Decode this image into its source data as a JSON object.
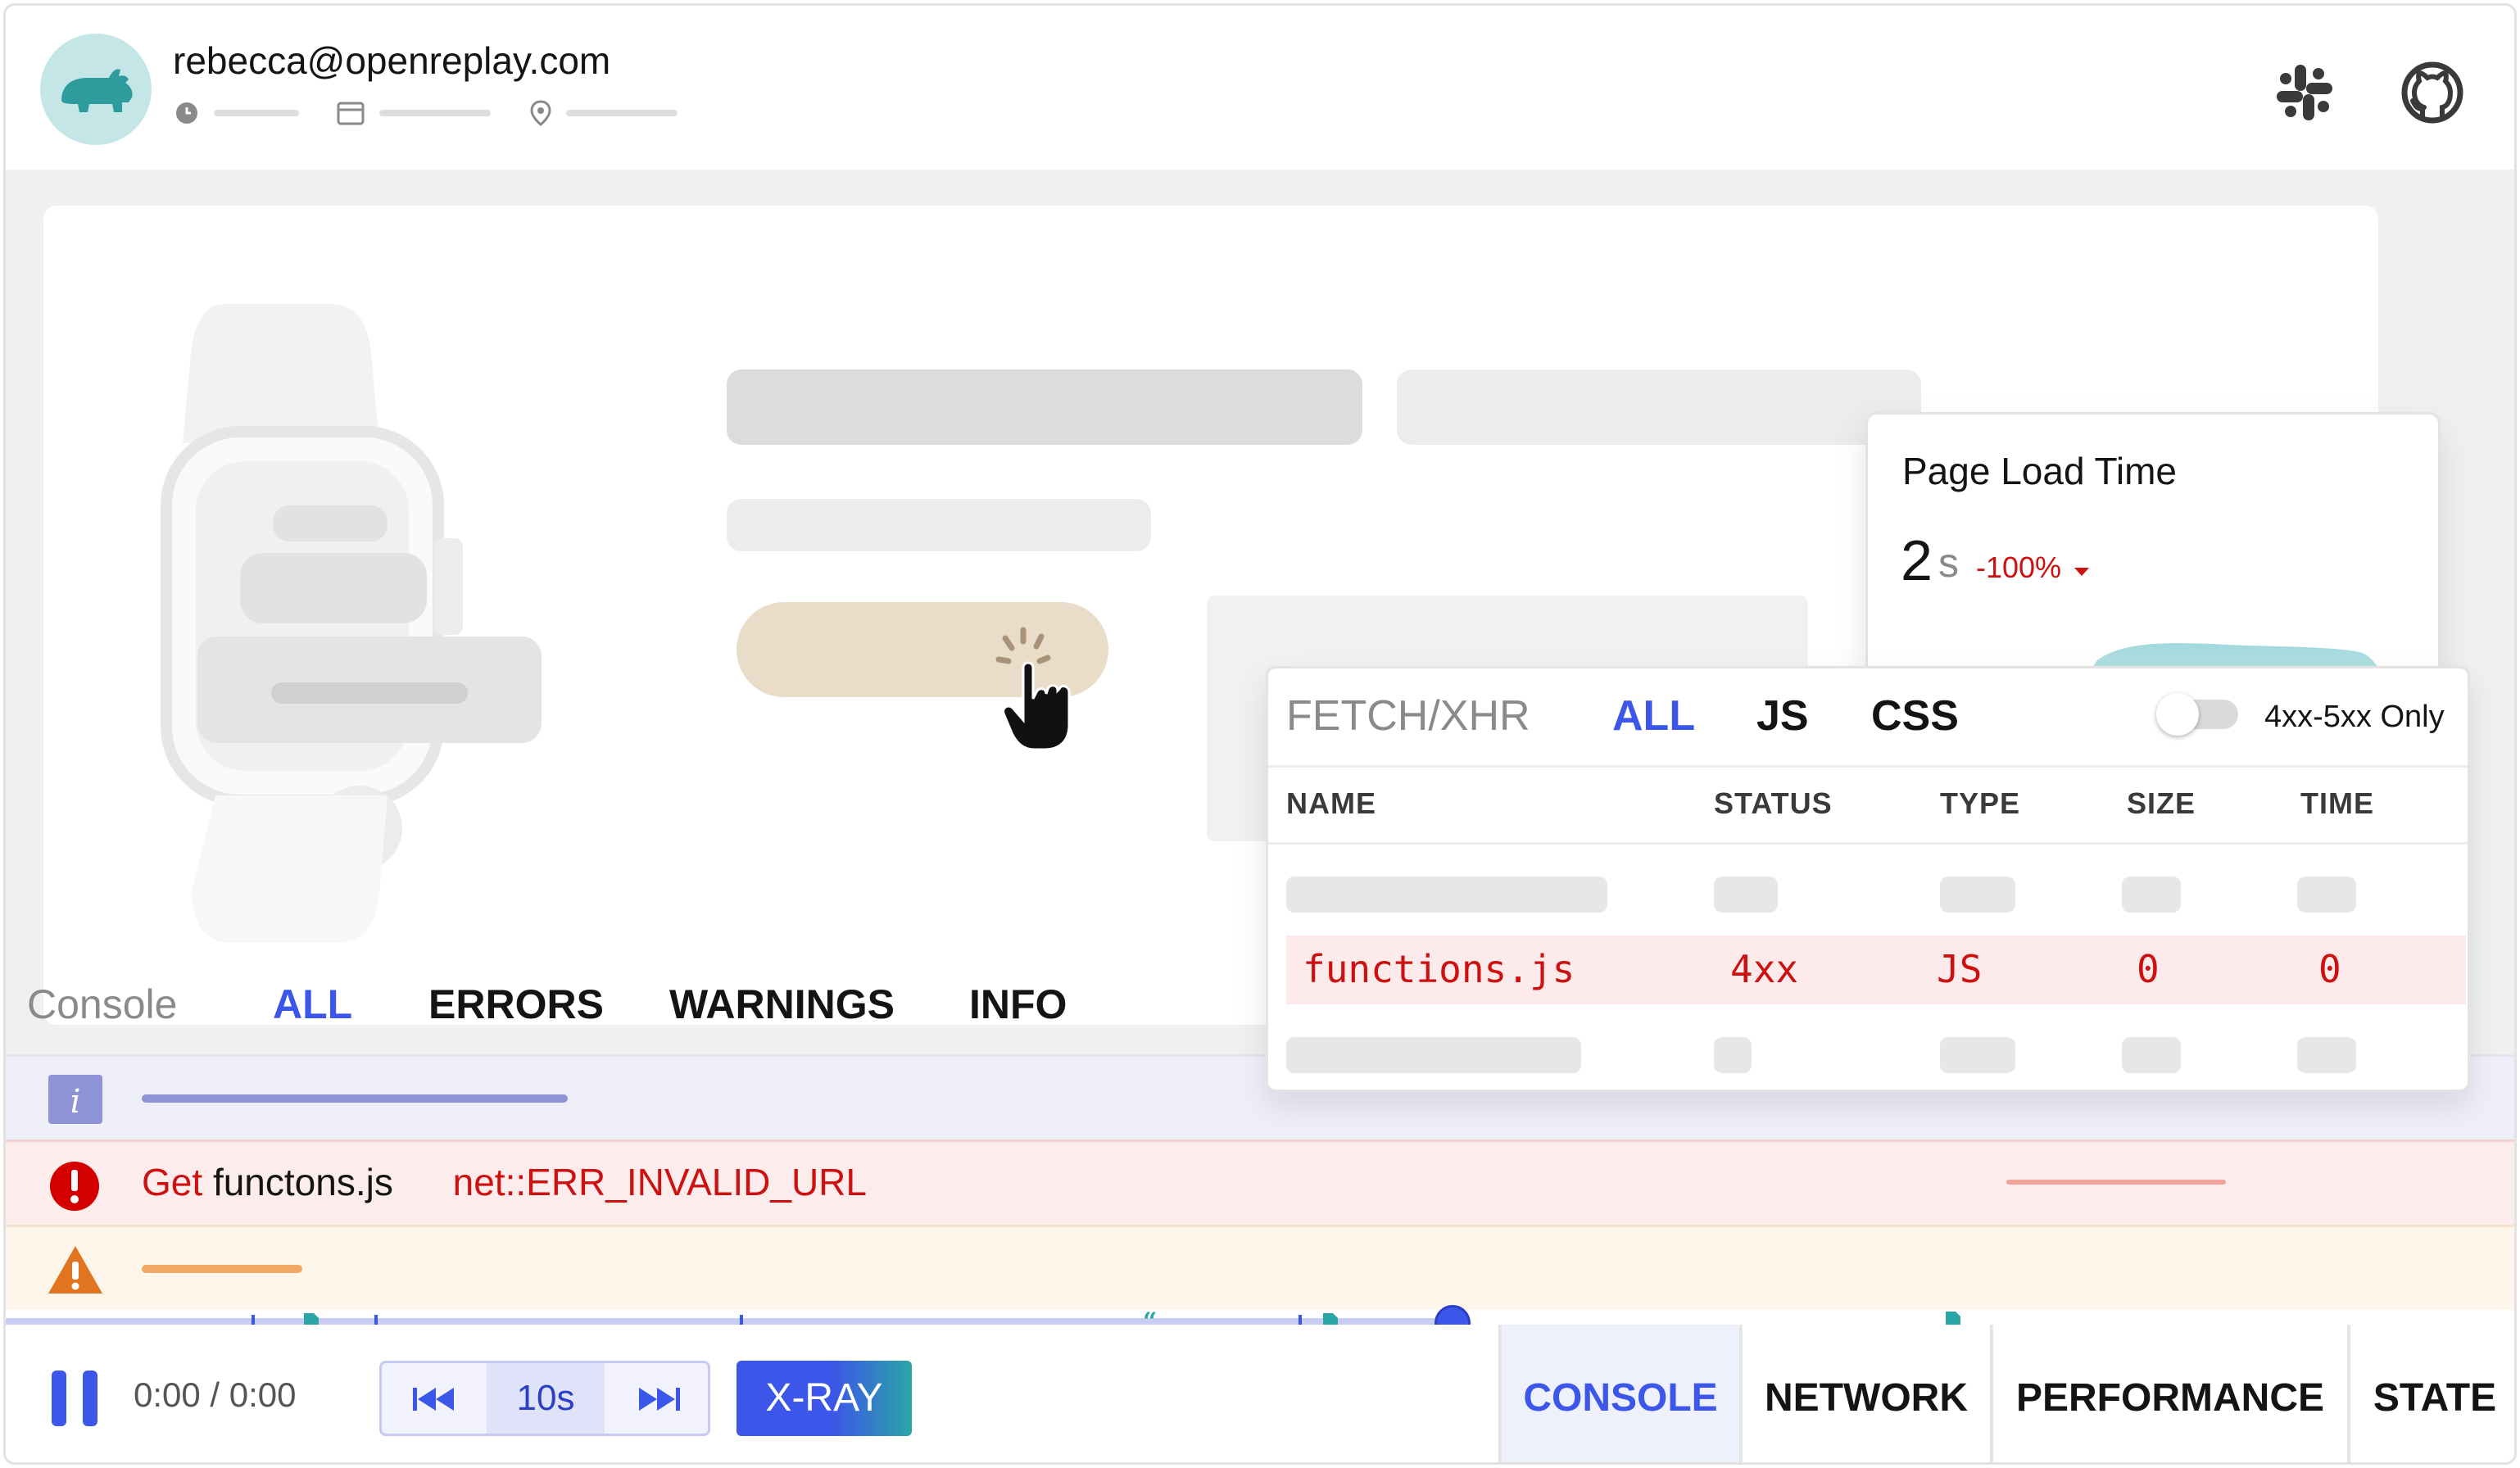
{
  "header": {
    "user_email": "rebecca@openreplay.com",
    "meta_icons": [
      "clock-icon",
      "calendar-icon",
      "location-pin-icon"
    ],
    "right_icons": [
      "slack-icon",
      "github-icon"
    ]
  },
  "page_load_card": {
    "title": "Page Load Time",
    "value": "2",
    "unit": "s",
    "delta": "-100%",
    "delta_color": "#cc1111",
    "chart_color": "#9fd8dc"
  },
  "network": {
    "tabs": [
      {
        "label": "FETCH/XHR",
        "active": false
      },
      {
        "label": "ALL",
        "active": true
      },
      {
        "label": "JS",
        "active": false
      },
      {
        "label": "CSS",
        "active": false
      }
    ],
    "toggle_label": "4xx-5xx Only",
    "toggle_on": false,
    "columns": [
      "NAME",
      "STATUS",
      "TYPE",
      "SIZE",
      "TIME"
    ],
    "error_row": {
      "name": "functions.js",
      "status": "4xx",
      "type": "JS",
      "size": "0",
      "time": "0"
    }
  },
  "console": {
    "title": "Console",
    "tabs": [
      {
        "label": "ALL",
        "active": true
      },
      {
        "label": "ERRORS",
        "active": false
      },
      {
        "label": "WARNINGS",
        "active": false
      },
      {
        "label": "INFO",
        "active": false
      }
    ],
    "error_message": {
      "prefix": "Get",
      "file": "functons.js",
      "detail": "net::ERR_INVALID_URL"
    }
  },
  "player": {
    "time": "0:00 / 0:00",
    "skip_label": "10s",
    "xray_label": "X-RAY",
    "accent_color": "#3b56e8",
    "bottom_tabs": [
      {
        "label": "CONSOLE",
        "active": true
      },
      {
        "label": "NETWORK",
        "active": false
      },
      {
        "label": "PERFORMANCE",
        "active": false
      },
      {
        "label": "STATE",
        "active": false
      }
    ]
  }
}
